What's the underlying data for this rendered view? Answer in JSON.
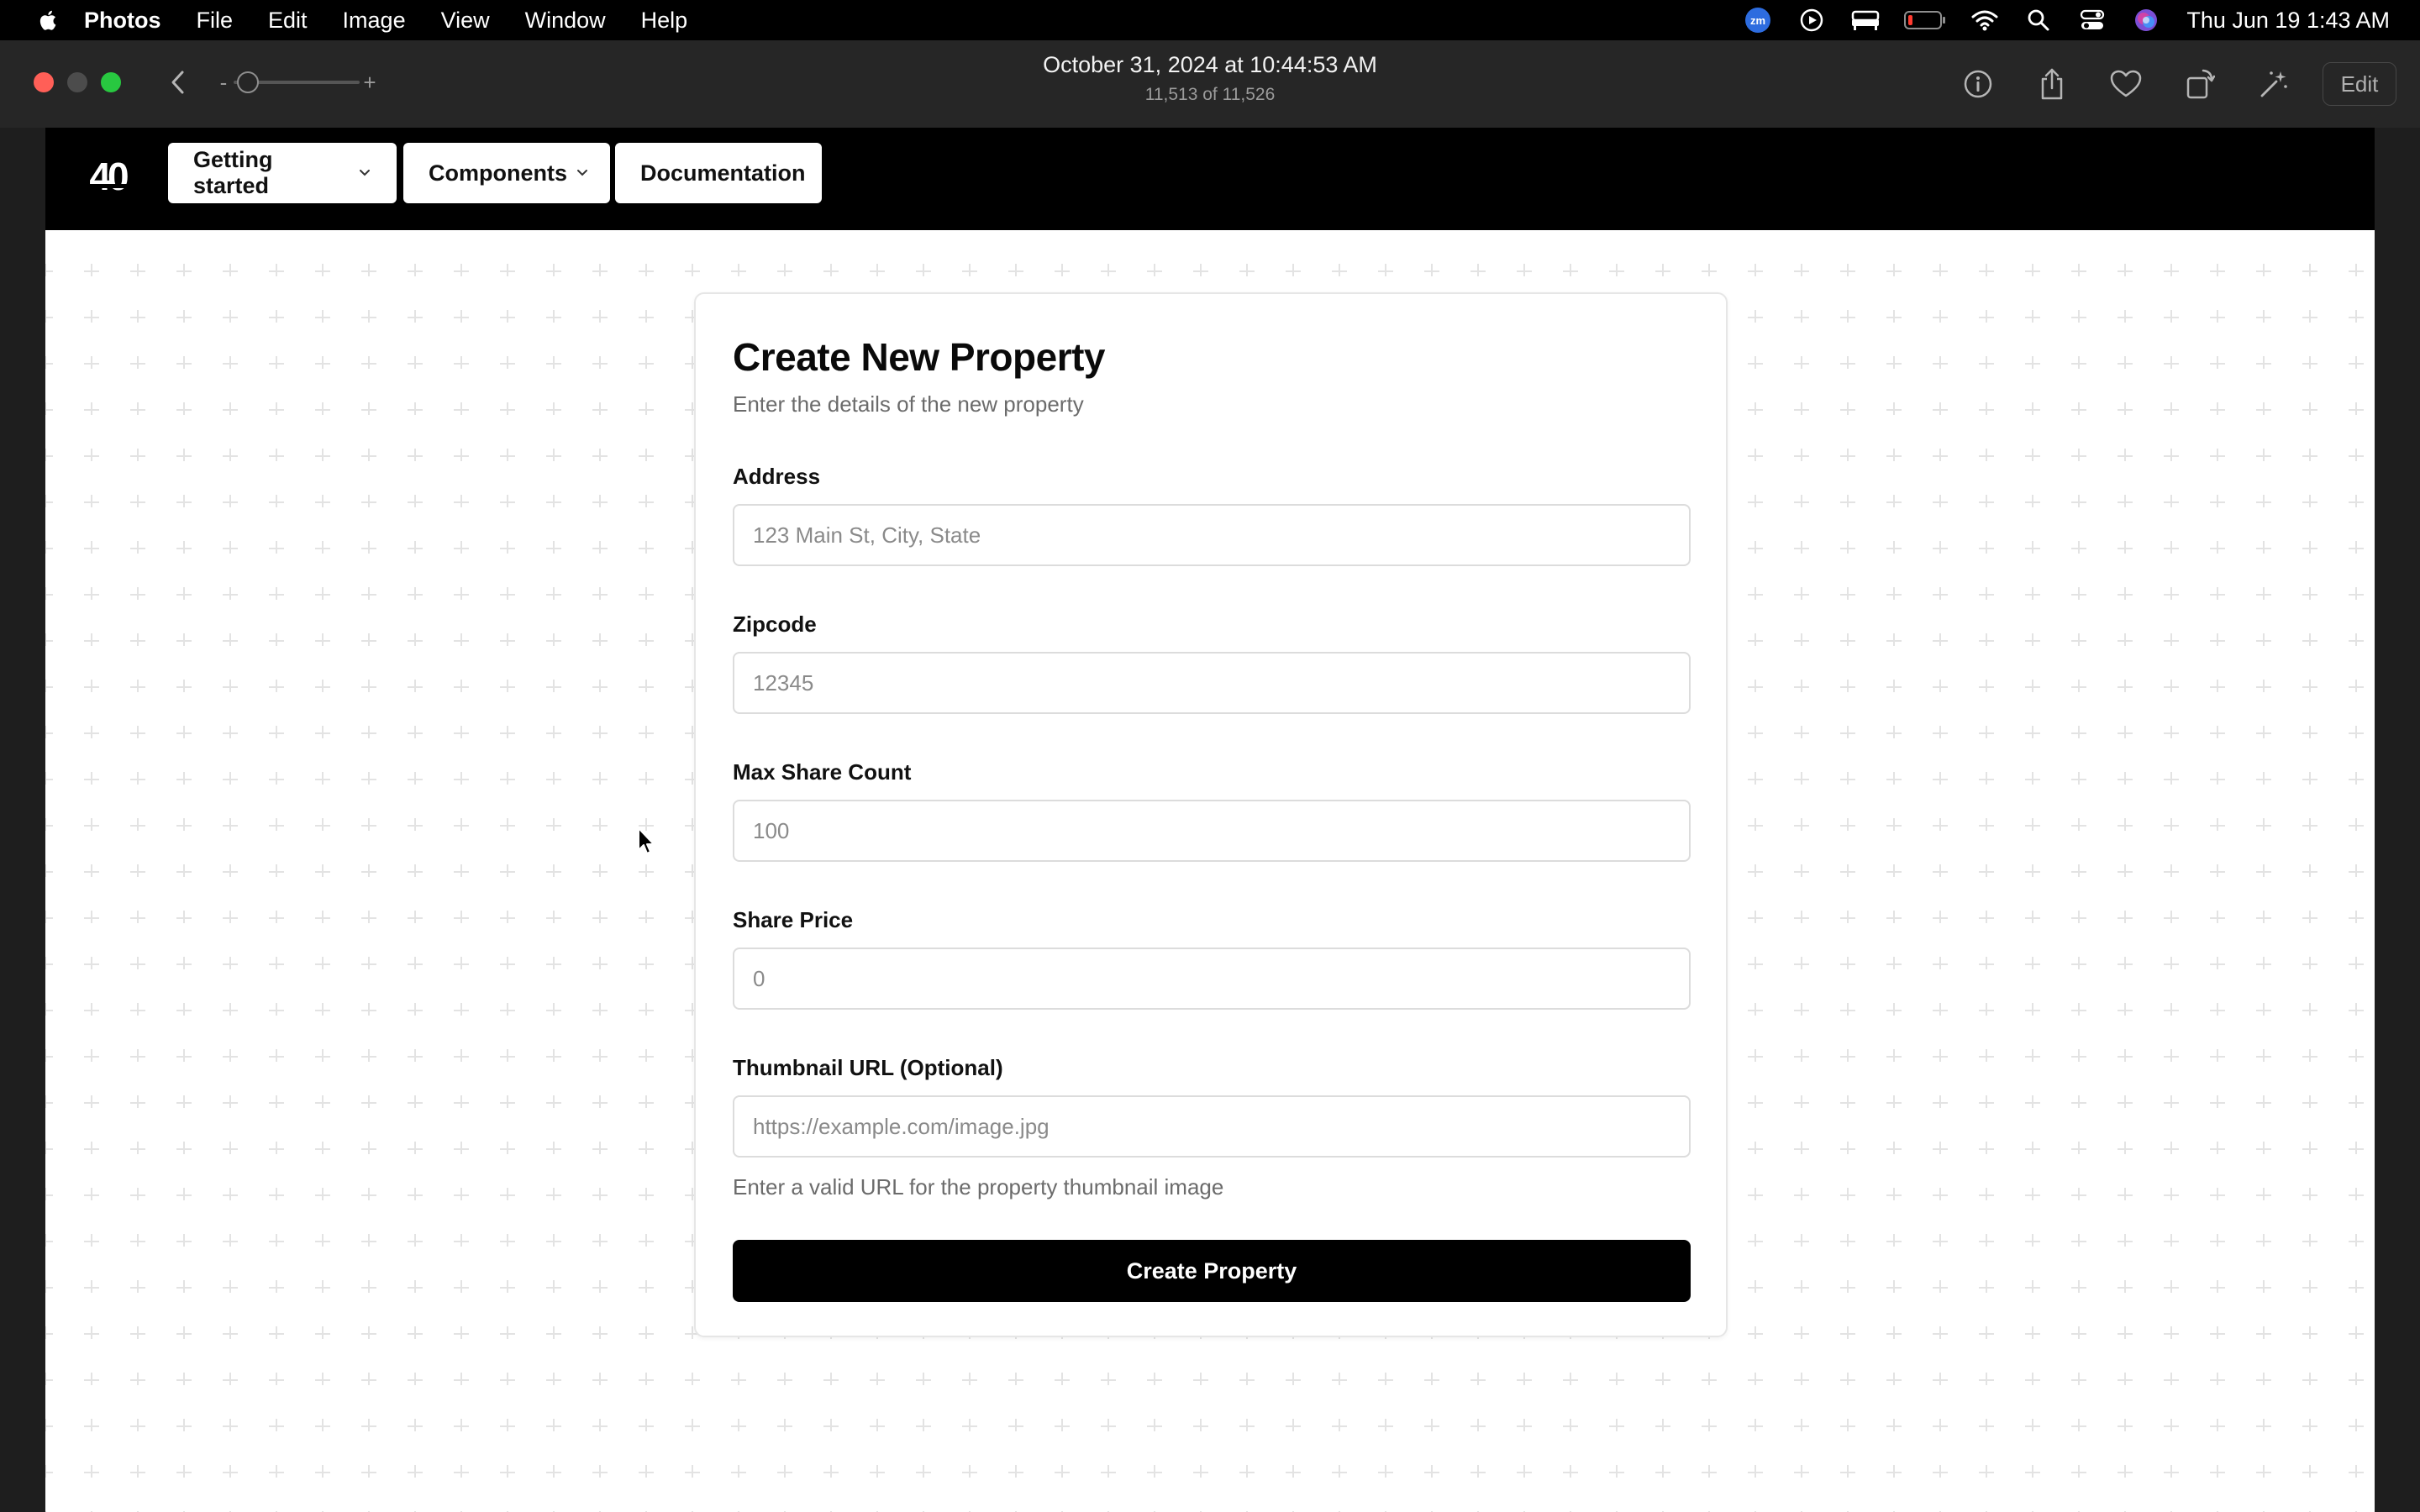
{
  "menubar": {
    "app_name": "Photos",
    "items": [
      "File",
      "Edit",
      "Image",
      "View",
      "Window",
      "Help"
    ],
    "clock": "Thu Jun 19  1:43 AM",
    "status_icons": [
      "zoom-icon",
      "play-circle-icon",
      "bed-icon",
      "battery-icon",
      "wifi-icon",
      "search-icon",
      "control-center-icon",
      "siri-icon"
    ]
  },
  "toolbar": {
    "title": "October 31, 2024 at 10:44:53 AM",
    "subtitle": "11,513 of 11,526",
    "zoom_minus": "-",
    "zoom_plus": "+",
    "edit_label": "Edit",
    "icons": [
      "info-icon",
      "share-icon",
      "heart-icon",
      "rotate-icon",
      "magic-wand-icon"
    ]
  },
  "site": {
    "nav": [
      {
        "label": "Getting started",
        "has_dropdown": true
      },
      {
        "label": "Components",
        "has_dropdown": true
      },
      {
        "label": "Documentation",
        "has_dropdown": false
      }
    ]
  },
  "form": {
    "title": "Create New Property",
    "subtitle": "Enter the details of the new property",
    "fields": [
      {
        "label": "Address",
        "placeholder": "123 Main St, City, State",
        "value": ""
      },
      {
        "label": "Zipcode",
        "placeholder": "12345",
        "value": ""
      },
      {
        "label": "Max Share Count",
        "placeholder": "100",
        "value": ""
      },
      {
        "label": "Share Price",
        "placeholder": "0",
        "value": ""
      },
      {
        "label": "Thumbnail URL (Optional)",
        "placeholder": "https://example.com/image.jpg",
        "value": ""
      }
    ],
    "help_text": "Enter a valid URL for the property thumbnail image",
    "submit_label": "Create Property"
  },
  "colors": {
    "menubar_bg": "#000000",
    "toolbar_bg": "#262626",
    "accent_button": "#000000",
    "pattern_plus": "#e3e3e3",
    "zoom_app_blue": "#2d6cdf"
  }
}
